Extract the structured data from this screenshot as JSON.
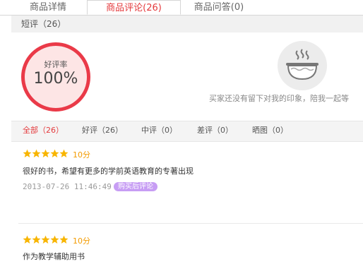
{
  "tabs": [
    {
      "label": "商品详情"
    },
    {
      "label": "商品评论(26)"
    },
    {
      "label": "商品问答(0)"
    }
  ],
  "short_review": {
    "label": "短评（26）"
  },
  "rating": {
    "label": "好评率",
    "value": "100%"
  },
  "impression": {
    "empty_text": "买家还没有留下对我的印象，陪我一起等"
  },
  "filters": [
    {
      "label": "全部（26）",
      "active": true
    },
    {
      "label": "好评（26）"
    },
    {
      "label": "中评（0）"
    },
    {
      "label": "差评（0）"
    },
    {
      "label": "晒图（0）"
    }
  ],
  "reviews": [
    {
      "stars": 5,
      "score": "10分",
      "text": "很好的书，希望有更多的学前英语教育的专著出现",
      "date": "2013-07-26 11:46:49",
      "badge": "购买后评论"
    },
    {
      "stars": 5,
      "score": "10分",
      "text": "作为教学辅助用书"
    }
  ],
  "colors": {
    "accent": "#e4393c",
    "star": "#f8b500",
    "badge": "#c79df4",
    "ring": "#ea3a48"
  }
}
